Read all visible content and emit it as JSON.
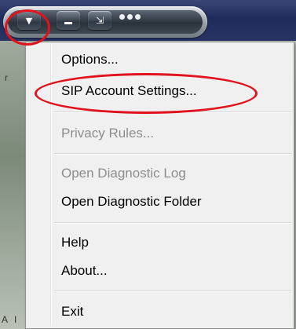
{
  "toolbar": {
    "menu_button_glyph": "▼",
    "minimize_glyph": "minimize-icon",
    "dock_glyph": "⇲"
  },
  "menu": {
    "items": [
      {
        "label": "Options...",
        "enabled": true
      },
      {
        "label": "SIP Account Settings...",
        "enabled": true
      },
      {
        "label": "Privacy Rules...",
        "enabled": false
      },
      {
        "label": "Open Diagnostic Log",
        "enabled": false
      },
      {
        "label": "Open Diagnostic Folder",
        "enabled": true
      },
      {
        "label": "Help",
        "enabled": true
      },
      {
        "label": "About...",
        "enabled": true
      },
      {
        "label": "Exit",
        "enabled": true
      }
    ]
  },
  "background": {
    "stray_text_1": "r",
    "stray_text_2": "A",
    "stray_text_3": "I"
  },
  "colors": {
    "highlight_ring": "#e0121d",
    "menu_background": "#f0f0f0",
    "disabled_text": "#8d8d8d",
    "titlebar": "#1f2b5a"
  }
}
